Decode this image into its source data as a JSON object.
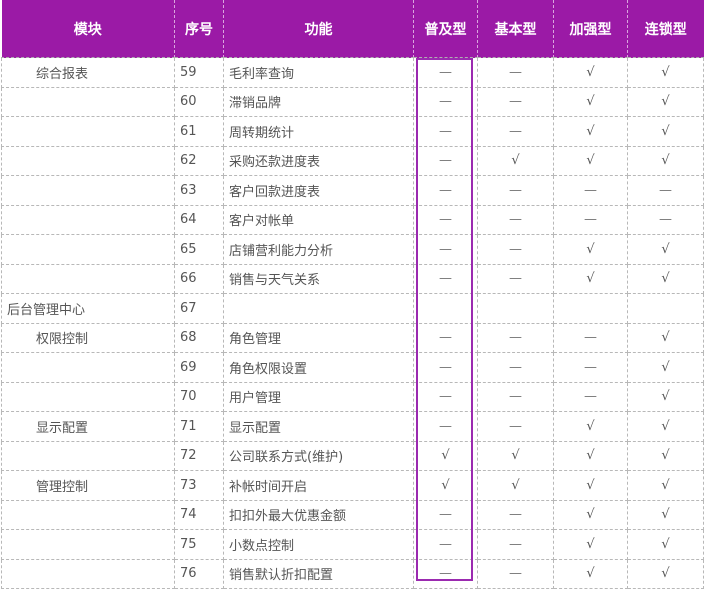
{
  "header": {
    "module": "模块",
    "seq": "序号",
    "function": "功能",
    "tier_popular": "普及型",
    "tier_basic": "基本型",
    "tier_enhanced": "加强型",
    "tier_chain": "连锁型"
  },
  "symbols": {
    "yes": "√",
    "no": "—"
  },
  "colors": {
    "header_background": "#9b1aa6",
    "header_text": "#ffffff",
    "highlight_border": "#9b2ab0",
    "grid_line": "#b8b8b8"
  },
  "highlighted_column": "普及型",
  "rows": [
    {
      "module": "综合报表",
      "level": 1,
      "seq": "59",
      "function": "毛利率查询",
      "marks": [
        "—",
        "—",
        "√",
        "√"
      ]
    },
    {
      "module": "",
      "level": 1,
      "seq": "60",
      "function": "滞销品牌",
      "marks": [
        "—",
        "—",
        "√",
        "√"
      ]
    },
    {
      "module": "",
      "level": 1,
      "seq": "61",
      "function": "周转期统计",
      "marks": [
        "—",
        "—",
        "√",
        "√"
      ]
    },
    {
      "module": "",
      "level": 1,
      "seq": "62",
      "function": "采购还款进度表",
      "marks": [
        "—",
        "√",
        "√",
        "√"
      ]
    },
    {
      "module": "",
      "level": 1,
      "seq": "63",
      "function": "客户回款进度表",
      "marks": [
        "—",
        "—",
        "—",
        "—"
      ]
    },
    {
      "module": "",
      "level": 1,
      "seq": "64",
      "function": "客户对帐单",
      "marks": [
        "—",
        "—",
        "—",
        "—"
      ]
    },
    {
      "module": "",
      "level": 1,
      "seq": "65",
      "function": "店铺营利能力分析",
      "marks": [
        "—",
        "—",
        "√",
        "√"
      ]
    },
    {
      "module": "",
      "level": 1,
      "seq": "66",
      "function": "销售与天气关系",
      "marks": [
        "—",
        "—",
        "√",
        "√"
      ]
    },
    {
      "module": "后台管理中心",
      "level": 0,
      "seq": "67",
      "function": "",
      "marks": [
        "",
        "",
        "",
        ""
      ]
    },
    {
      "module": "权限控制",
      "level": 1,
      "seq": "68",
      "function": "角色管理",
      "marks": [
        "—",
        "—",
        "—",
        "√"
      ]
    },
    {
      "module": "",
      "level": 1,
      "seq": "69",
      "function": "角色权限设置",
      "marks": [
        "—",
        "—",
        "—",
        "√"
      ]
    },
    {
      "module": "",
      "level": 1,
      "seq": "70",
      "function": "用户管理",
      "marks": [
        "—",
        "—",
        "—",
        "√"
      ]
    },
    {
      "module": "显示配置",
      "level": 1,
      "seq": "71",
      "function": "显示配置",
      "marks": [
        "—",
        "—",
        "√",
        "√"
      ]
    },
    {
      "module": "",
      "level": 1,
      "seq": "72",
      "function": "公司联系方式(维护)",
      "marks": [
        "√",
        "√",
        "√",
        "√"
      ]
    },
    {
      "module": "管理控制",
      "level": 1,
      "seq": "73",
      "function": "补帐时间开启",
      "marks": [
        "√",
        "√",
        "√",
        "√"
      ]
    },
    {
      "module": "",
      "level": 1,
      "seq": "74",
      "function": "扣扣外最大优惠金额",
      "marks": [
        "—",
        "—",
        "√",
        "√"
      ]
    },
    {
      "module": "",
      "level": 1,
      "seq": "75",
      "function": "小数点控制",
      "marks": [
        "—",
        "—",
        "√",
        "√"
      ]
    },
    {
      "module": "",
      "level": 1,
      "seq": "76",
      "function": "销售默认折扣配置",
      "marks": [
        "—",
        "—",
        "√",
        "√"
      ]
    }
  ]
}
